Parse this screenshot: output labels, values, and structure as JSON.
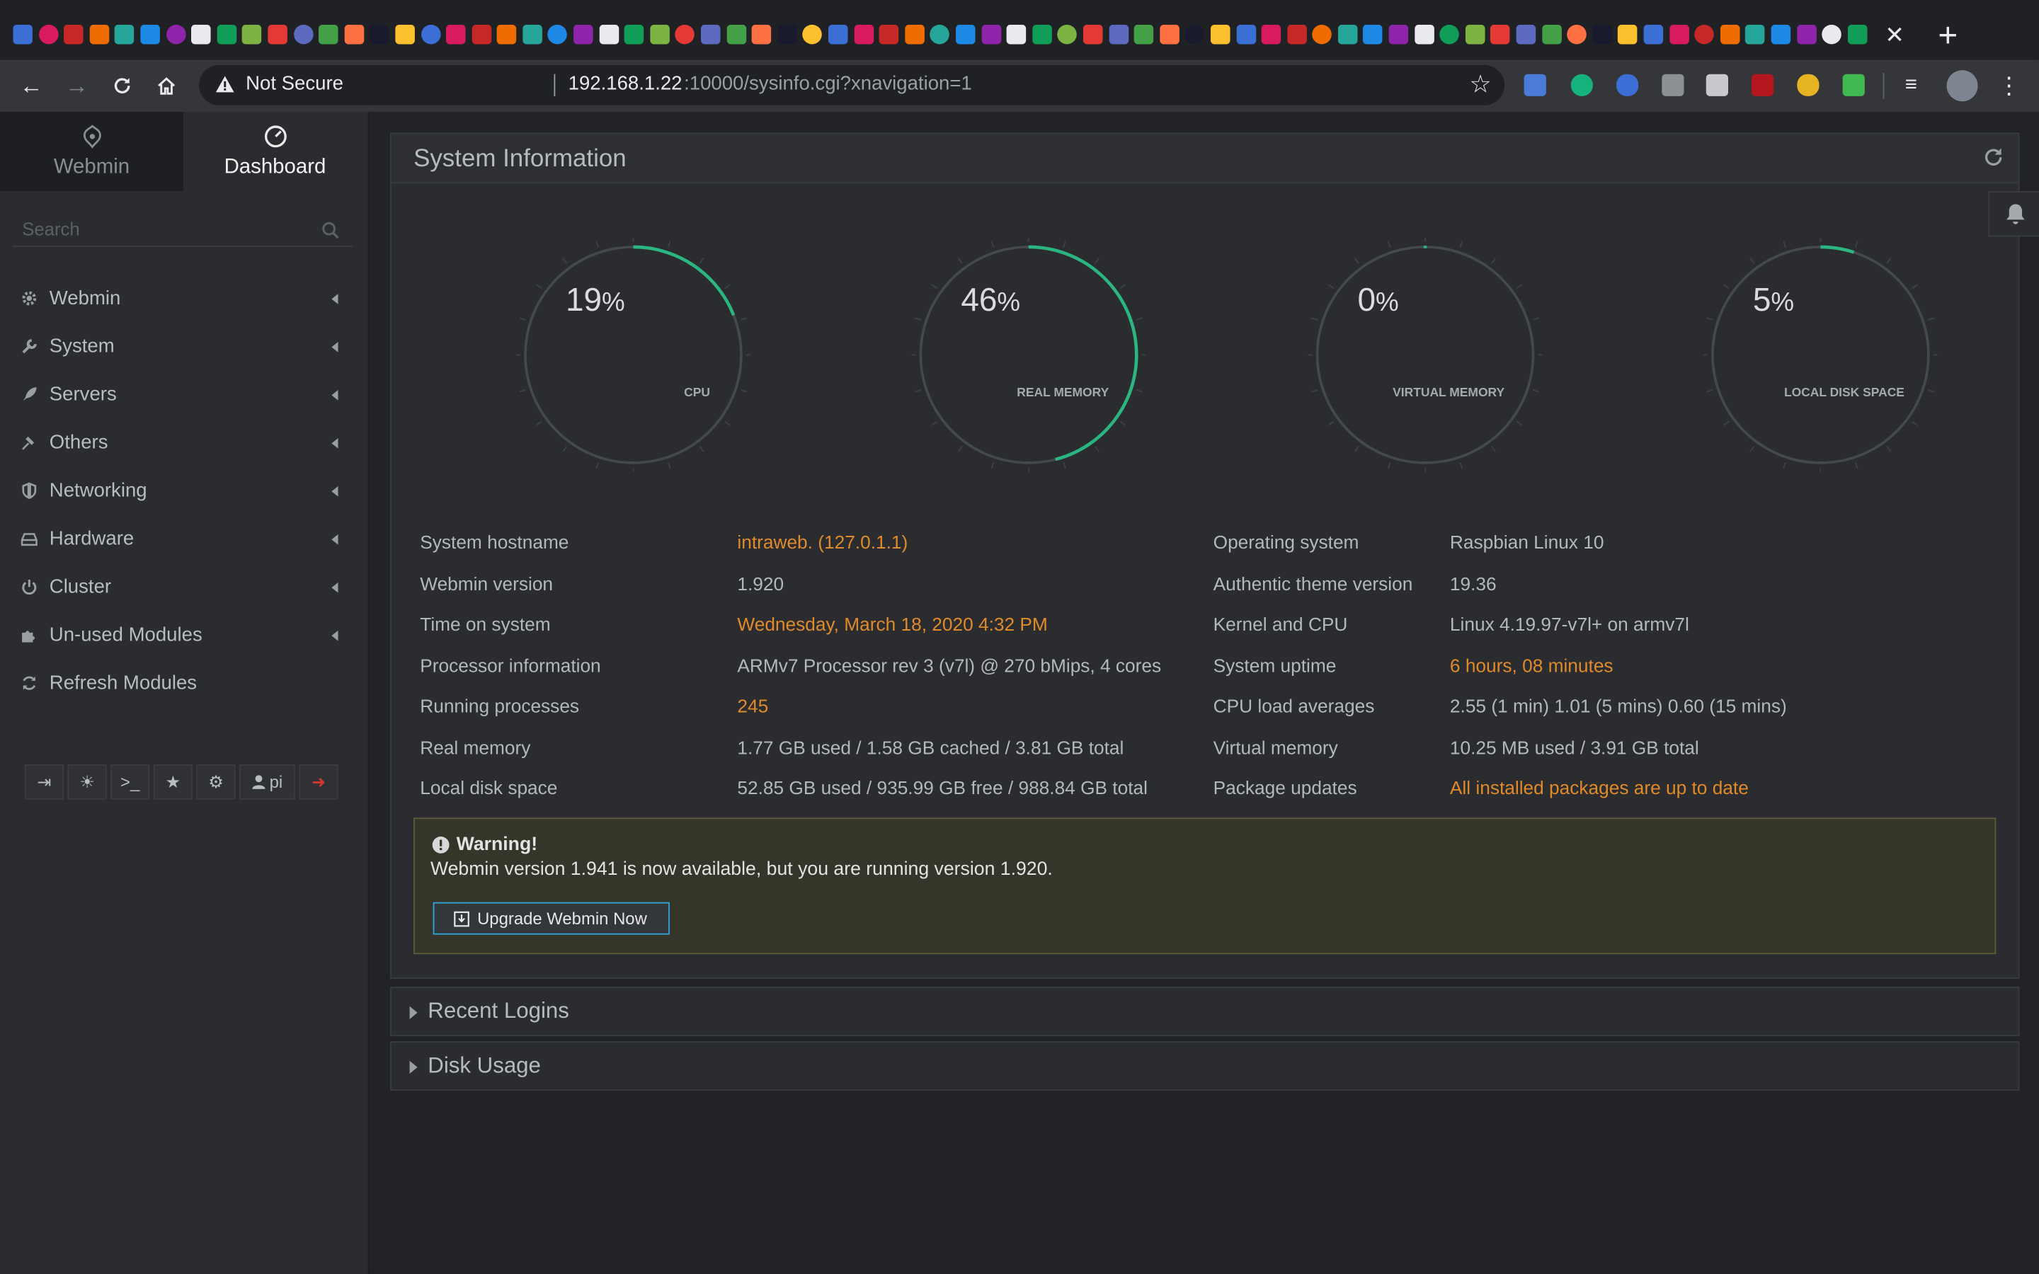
{
  "browser": {
    "security_label": "Not Secure",
    "url_host": "192.168.1.22",
    "url_path": ":10000/sysinfo.cgi?xnavigation=1",
    "tab_close": "✕",
    "new_tab": "+"
  },
  "sidebar": {
    "tabs": [
      {
        "label": "Webmin"
      },
      {
        "label": "Dashboard"
      }
    ],
    "search_placeholder": "Search",
    "items": [
      {
        "label": "Webmin",
        "icon": "gear-icon"
      },
      {
        "label": "System",
        "icon": "wrench-icon"
      },
      {
        "label": "Servers",
        "icon": "rocket-icon"
      },
      {
        "label": "Others",
        "icon": "gavel-icon"
      },
      {
        "label": "Networking",
        "icon": "shield-icon"
      },
      {
        "label": "Hardware",
        "icon": "hdd-icon"
      },
      {
        "label": "Cluster",
        "icon": "power-icon"
      },
      {
        "label": "Un-used Modules",
        "icon": "puzzle-icon"
      },
      {
        "label": "Refresh Modules",
        "icon": "refresh-icon"
      }
    ],
    "tools": {
      "terminal": ">_",
      "user": "pi"
    }
  },
  "panel": {
    "title": "System Information"
  },
  "gauges": [
    {
      "value": "19",
      "unit": "%",
      "label": "CPU",
      "fraction": 0.19
    },
    {
      "value": "46",
      "unit": "%",
      "label": "REAL MEMORY",
      "fraction": 0.46
    },
    {
      "value": "0",
      "unit": "%",
      "label": "VIRTUAL MEMORY",
      "fraction": 0.0
    },
    {
      "value": "5",
      "unit": "%",
      "label": "LOCAL DISK SPACE",
      "fraction": 0.05
    }
  ],
  "info_left": [
    {
      "key": "System hostname",
      "value": "intraweb. (127.0.1.1)"
    },
    {
      "key": "Webmin version",
      "value": "1.920"
    },
    {
      "key": "Time on system",
      "value": "Wednesday, March 18, 2020 4:32 PM"
    },
    {
      "key": "Processor information",
      "value": "ARMv7 Processor rev 3 (v7l) @ 270 bMips, 4 cores"
    },
    {
      "key": "Running processes",
      "value": "245"
    },
    {
      "key": "Real memory",
      "value": "1.77 GB used / 1.58 GB cached / 3.81 GB total"
    },
    {
      "key": "Local disk space",
      "value": "52.85 GB used / 935.99 GB free / 988.84 GB total"
    }
  ],
  "info_right": [
    {
      "key": "Operating system",
      "value": "Raspbian Linux 10"
    },
    {
      "key": "Authentic theme version",
      "value": "19.36"
    },
    {
      "key": "Kernel and CPU",
      "value": "Linux 4.19.97-v7l+ on armv7l"
    },
    {
      "key": "System uptime",
      "value": "6 hours, 08 minutes"
    },
    {
      "key": "CPU load averages",
      "value": "2.55 (1 min) 1.01 (5 mins) 0.60 (15 mins)"
    },
    {
      "key": "Virtual memory",
      "value": "10.25 MB used / 3.91 GB total"
    },
    {
      "key": "Package updates",
      "value": "All installed packages are up to date"
    }
  ],
  "alert": {
    "title": "Warning!",
    "message": "Webmin version 1.941 is now available, but you are running version 1.920.",
    "button": "Upgrade Webmin Now"
  },
  "sections": [
    {
      "label": "Recent Logins"
    },
    {
      "label": "Disk Usage"
    }
  ],
  "colors": {
    "gauge_fill": "#2bb580",
    "gauge_track": "#45484d",
    "link_orange": "#e08a2a"
  }
}
